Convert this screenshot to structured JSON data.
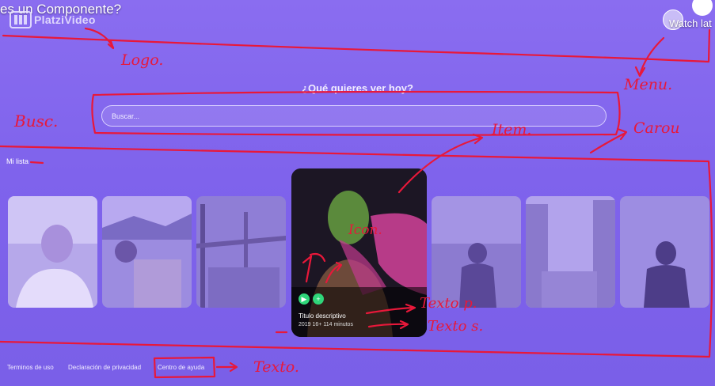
{
  "video_title": "es un Componente?",
  "watch_later_label": "Watch lat",
  "header": {
    "logo_text": "PlatziVideo"
  },
  "search": {
    "heading": "¿Qué quieres ver hoy?",
    "placeholder": "Buscar..."
  },
  "carousel": {
    "section_label": "Mi lista",
    "featured": {
      "title": "Titulo descriptivo",
      "meta": "2019 16+ 114 minutos"
    }
  },
  "footer": {
    "links": [
      "Terminos de uso",
      "Declaración de privacidad",
      "Centro de ayuda"
    ]
  },
  "annotations": [
    "Logo.",
    "Menu.",
    "Busc.",
    "Item.",
    "Carou",
    "Icon.",
    "Texto p.",
    "Texto s.",
    "Texto."
  ],
  "colors": {
    "background": "#8066ee",
    "annotation": "#e8183a",
    "accent_button": "#2fd67a"
  }
}
